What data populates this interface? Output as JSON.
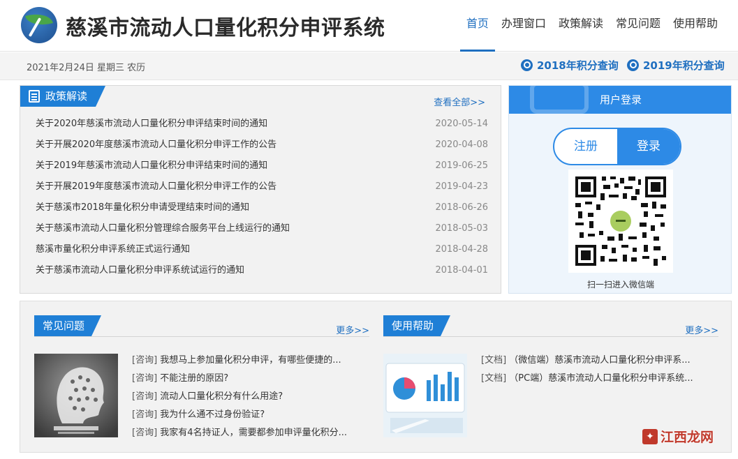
{
  "header": {
    "title": "慈溪市流动人口量化积分申评系统",
    "nav": [
      "首页",
      "办理窗口",
      "政策解读",
      "常见问题",
      "使用帮助"
    ]
  },
  "datebar": {
    "date": "2021年2月24日 星期三 农历",
    "query_2018": "2018年积分查询",
    "query_2019": "2019年积分查询"
  },
  "policy": {
    "title": "政策解读",
    "more": "查看全部>>",
    "items": [
      {
        "title": "关于2020年慈溪市流动人口量化积分申评结束时间的通知",
        "date": "2020-05-14"
      },
      {
        "title": "关于开展2020年度慈溪市流动人口量化积分申评工作的公告",
        "date": "2020-04-08"
      },
      {
        "title": "关于2019年慈溪市流动人口量化积分申评结束时间的通知",
        "date": "2019-06-25"
      },
      {
        "title": "关于开展2019年度慈溪市流动人口量化积分申评工作的公告",
        "date": "2019-04-23"
      },
      {
        "title": "关于慈溪市2018年量化积分申请受理结束时间的通知",
        "date": "2018-06-26"
      },
      {
        "title": "关于慈溪市流动人口量化积分管理综合服务平台上线运行的通知",
        "date": "2018-05-03"
      },
      {
        "title": "慈溪市量化积分申评系统正式运行通知",
        "date": "2018-04-28"
      },
      {
        "title": "关于慈溪市流动人口量化积分申评系统试运行的通知",
        "date": "2018-04-01"
      }
    ]
  },
  "login": {
    "title": "用户登录",
    "register": "注册",
    "login": "登录",
    "qr_caption": "扫一扫进入微信端"
  },
  "faq": {
    "title": "常见问题",
    "more": "更多>>",
    "items": [
      {
        "tag": "[咨询]",
        "text": "我想马上参加量化积分申评，有哪些便捷的..."
      },
      {
        "tag": "[咨询]",
        "text": "不能注册的原因?"
      },
      {
        "tag": "[咨询]",
        "text": "流动人口量化积分有什么用途?"
      },
      {
        "tag": "[咨询]",
        "text": "我为什么通不过身份验证?"
      },
      {
        "tag": "[咨询]",
        "text": "我家有4名持证人，需要都参加申评量化积分..."
      }
    ]
  },
  "help": {
    "title": "使用帮助",
    "more": "更多>>",
    "items": [
      {
        "tag": "[文档]",
        "text": "（微信端）慈溪市流动人口量化积分申评系..."
      },
      {
        "tag": "[文档]",
        "text": "（PC端）慈溪市流动人口量化积分申评系统..."
      }
    ]
  },
  "watermark": "江西龙网",
  "colors": {
    "primary": "#1f7fd6",
    "link": "#1f6fc0",
    "panel_bg": "#f2f2f2",
    "login_bg": "#eef5fc"
  }
}
